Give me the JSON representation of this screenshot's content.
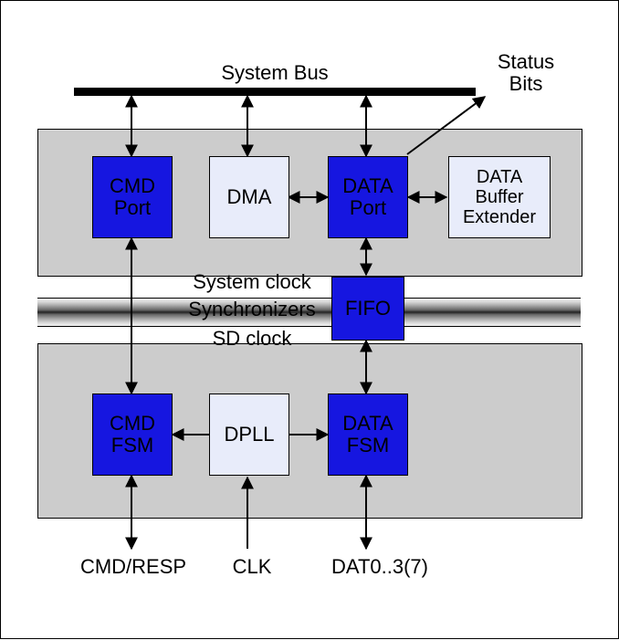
{
  "labels": {
    "system_bus": "System Bus",
    "status_bits": "Status\nBits",
    "system_clock": "System clock",
    "synchronizers": "Synchronizers",
    "sd_clock": "SD clock",
    "cmd_resp": "CMD/RESP",
    "clk": "CLK",
    "dat": "DAT0..3(7)"
  },
  "blocks": {
    "cmd_port": "CMD\nPort",
    "dma": "DMA",
    "data_port": "DATA\nPort",
    "data_buffer_extender": "DATA\nBuffer\nExtender",
    "fifo": "FIFO",
    "cmd_fsm": "CMD\nFSM",
    "dpll": "DPLL",
    "data_fsm": "DATA\nFSM"
  }
}
